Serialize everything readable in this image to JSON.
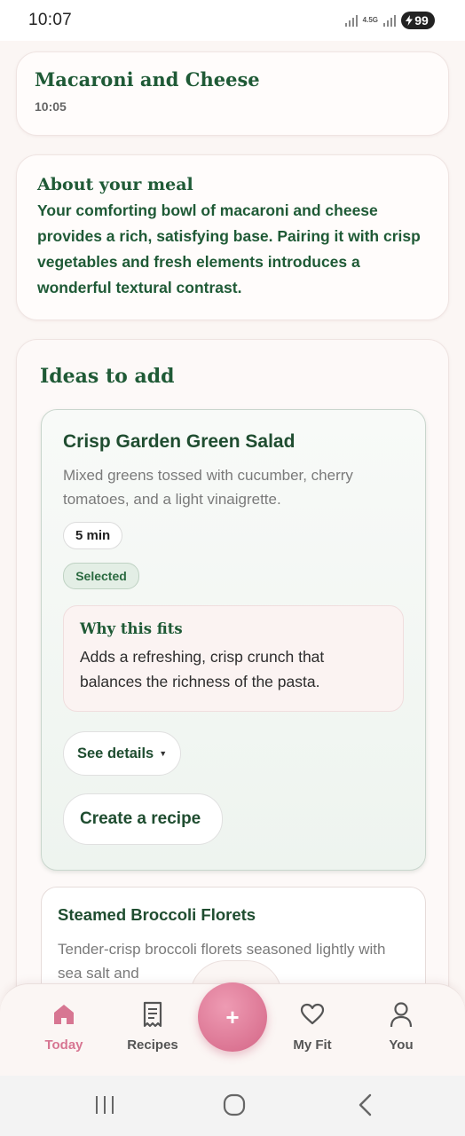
{
  "status_bar": {
    "time": "10:07",
    "network": "4.5G",
    "battery": "99"
  },
  "meal": {
    "title": "Macaroni and Cheese",
    "time": "10:05"
  },
  "about": {
    "title": "About your meal",
    "text": "Your comforting bowl of macaroni and cheese provides a rich, satisfying base. Pairing it with crisp vegetables and fresh elements introduces a wonderful textural contrast."
  },
  "ideas": {
    "title": "Ideas to add",
    "items": [
      {
        "title": "Crisp Garden Green Salad",
        "description": "Mixed greens tossed with cucumber, cherry tomatoes, and a light vinaigrette.",
        "time": "5 min",
        "status": "Selected",
        "why_title": "Why this fits",
        "why_text": "Adds a refreshing, crisp crunch that balances the richness of the pasta.",
        "details_label": "See details",
        "create_label": "Create a recipe"
      },
      {
        "title": "Steamed Broccoli Florets",
        "description": "Tender-crisp broccoli florets seasoned lightly with sea salt and"
      }
    ]
  },
  "bottom_nav": {
    "items": [
      {
        "label": "Today",
        "icon": "home-icon",
        "active": true
      },
      {
        "label": "Recipes",
        "icon": "receipt-icon",
        "active": false
      },
      {
        "label": "My Fit",
        "icon": "heart-icon",
        "active": false
      },
      {
        "label": "You",
        "icon": "person-icon",
        "active": false
      }
    ],
    "fab_symbol": "+"
  },
  "colors": {
    "primary_green": "#1f5a36",
    "accent_pink": "#d77692",
    "background": "#fbf6f4"
  }
}
